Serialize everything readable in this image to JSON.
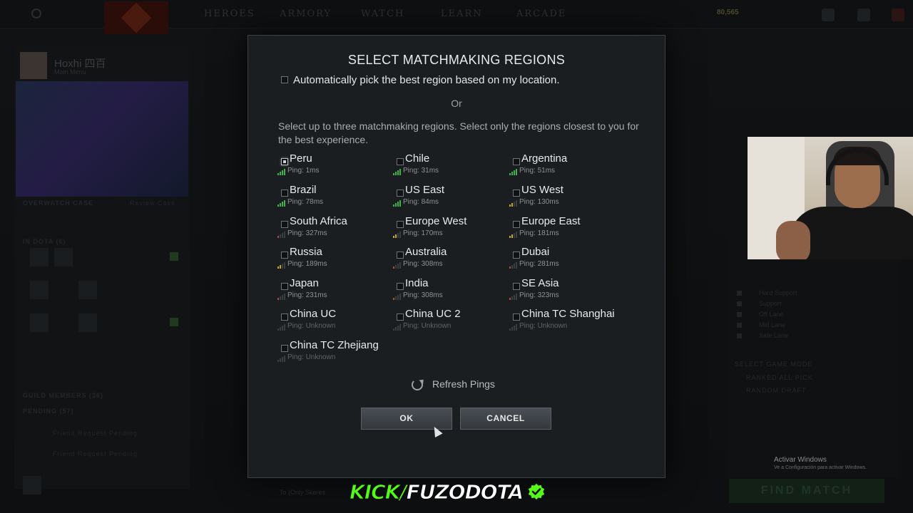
{
  "colors": {
    "ping_green": "#3fb34a",
    "ping_yellow": "#c8a629",
    "ping_red": "#b8473c",
    "ping_gray": "#4d5156",
    "kick_green": "#53fc18"
  },
  "background": {
    "nav_items": [
      "HEROES",
      "ARMORY",
      "WATCH",
      "LEARN",
      "ARCADE"
    ],
    "gold": "80,565",
    "profile": {
      "name": "Hoxhi 四百",
      "status": "Main Menu"
    },
    "overwatch_case": "OVERWATCH CASE",
    "review_case": "Review Case",
    "in_dota": "IN DOTA (6)",
    "guild_members": "GUILD MEMBERS (36)",
    "pending": "PENDING (57)",
    "friend_request": "Friend Request Pending",
    "roles": [
      "Hard Support",
      "Support",
      "Off Lane",
      "Mid Lane",
      "Safe Lane"
    ],
    "select_game_mode": "SELECT GAME MODE",
    "game_modes": [
      "RANKED ALL PICK",
      "RANDOM DRAFT"
    ],
    "find_match": "FIND MATCH",
    "activate_windows_title": "Activar Windows",
    "activate_windows_sub": "Ve a Configuración para activar Windows.",
    "chat_hint": "To (Only Skeres"
  },
  "dialog": {
    "title": "SELECT MATCHMAKING REGIONS",
    "auto_pick_label": "Automatically pick the best region based on my location.",
    "or_label": "Or",
    "instructions": "Select up to three matchmaking regions. Select only the regions closest to you for the best experience.",
    "regions": [
      {
        "name": "Peru",
        "ping": "Ping: 1ms",
        "quality": "green",
        "hovered": true
      },
      {
        "name": "Chile",
        "ping": "Ping: 31ms",
        "quality": "green"
      },
      {
        "name": "Argentina",
        "ping": "Ping: 51ms",
        "quality": "green"
      },
      {
        "name": "Brazil",
        "ping": "Ping: 78ms",
        "quality": "green"
      },
      {
        "name": "US East",
        "ping": "Ping: 84ms",
        "quality": "green"
      },
      {
        "name": "US West",
        "ping": "Ping: 130ms",
        "quality": "yellow"
      },
      {
        "name": "South Africa",
        "ping": "Ping: 327ms",
        "quality": "red"
      },
      {
        "name": "Europe West",
        "ping": "Ping: 170ms",
        "quality": "yellow"
      },
      {
        "name": "Europe East",
        "ping": "Ping: 181ms",
        "quality": "yellow"
      },
      {
        "name": "Russia",
        "ping": "Ping: 189ms",
        "quality": "yellow"
      },
      {
        "name": "Australia",
        "ping": "Ping: 308ms",
        "quality": "red"
      },
      {
        "name": "Dubai",
        "ping": "Ping: 281ms",
        "quality": "red"
      },
      {
        "name": "Japan",
        "ping": "Ping: 231ms",
        "quality": "red"
      },
      {
        "name": "India",
        "ping": "Ping: 308ms",
        "quality": "red"
      },
      {
        "name": "SE Asia",
        "ping": "Ping: 323ms",
        "quality": "red"
      },
      {
        "name": "China UC",
        "ping": "Ping: Unknown",
        "quality": "gray"
      },
      {
        "name": "China UC 2",
        "ping": "Ping: Unknown",
        "quality": "gray"
      },
      {
        "name": "China TC Shanghai",
        "ping": "Ping: Unknown",
        "quality": "gray"
      },
      {
        "name": "China TC Zhejiang",
        "ping": "Ping: Unknown",
        "quality": "gray"
      }
    ],
    "refresh_label": "Refresh Pings",
    "ok_label": "OK",
    "cancel_label": "CANCEL"
  },
  "overlay": {
    "brand": "KICK/",
    "channel": "FUZODOTA"
  }
}
